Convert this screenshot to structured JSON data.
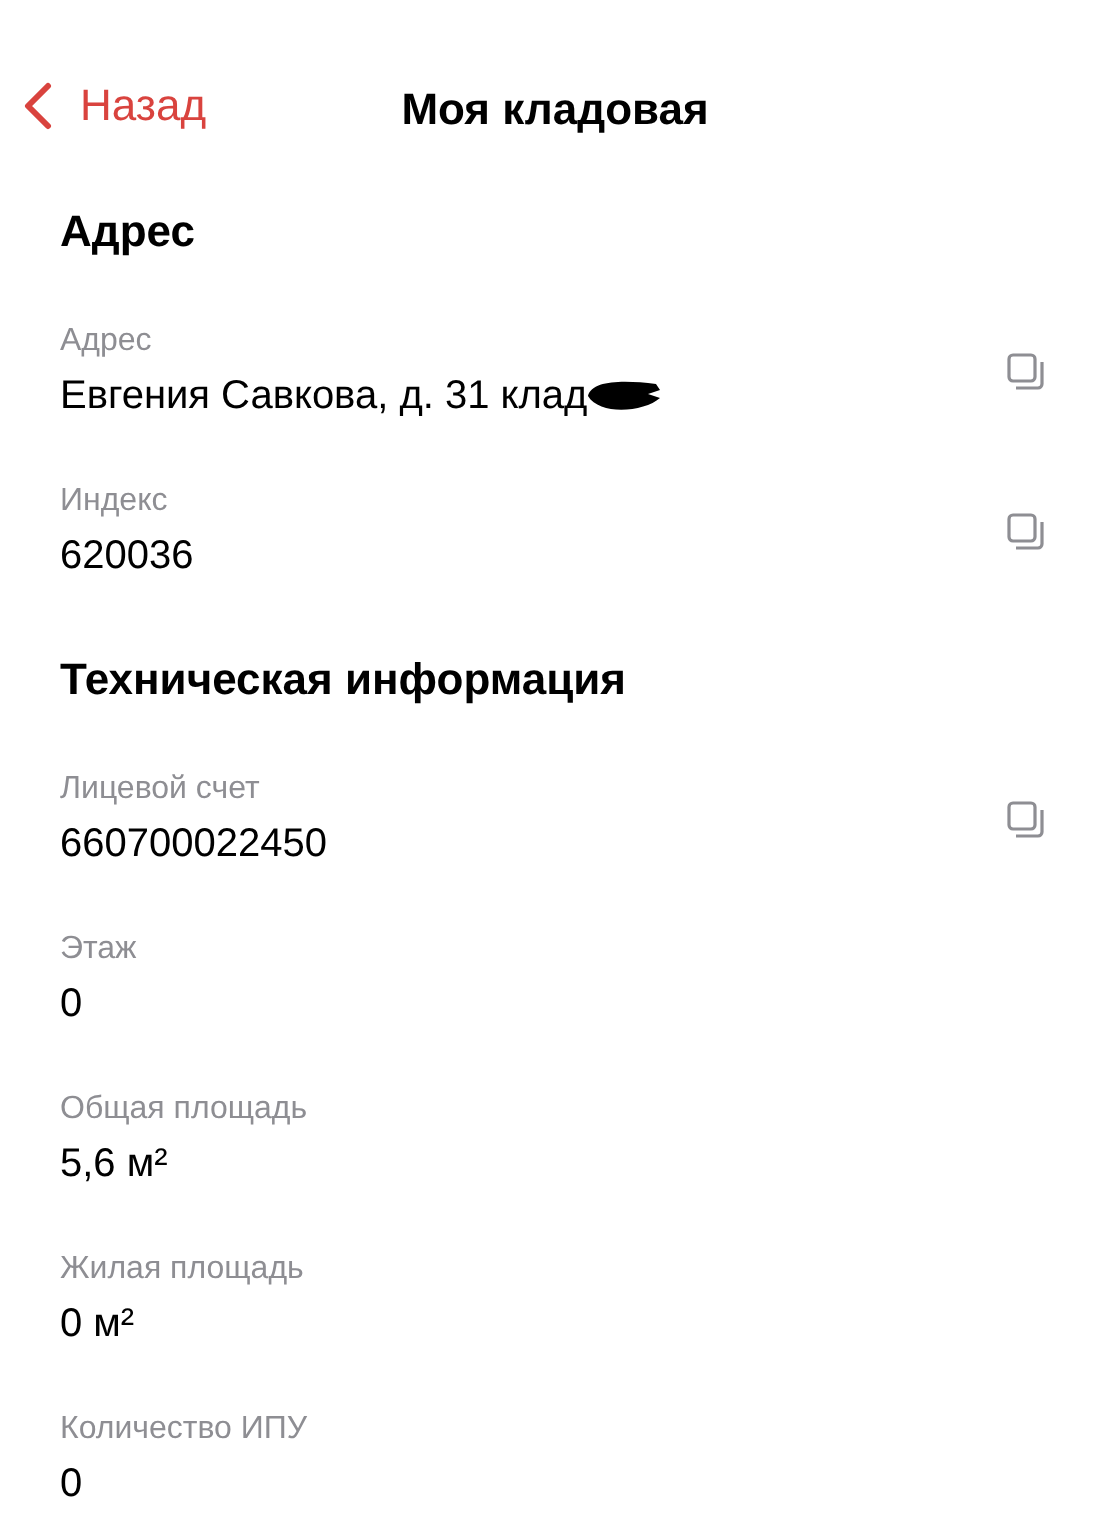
{
  "nav": {
    "back_label": "Назад",
    "title": "Моя кладовая"
  },
  "sections": [
    {
      "title": "Адрес",
      "fields": [
        {
          "label": "Адрес",
          "value": "Евгения Савкова, д. 31 клад",
          "redacted": true,
          "copyable": true
        },
        {
          "label": "Индекс",
          "value": "620036",
          "redacted": false,
          "copyable": true
        }
      ]
    },
    {
      "title": "Техническая информация",
      "fields": [
        {
          "label": "Лицевой счет",
          "value": "660700022450",
          "redacted": false,
          "copyable": true
        },
        {
          "label": "Этаж",
          "value": "0",
          "redacted": false,
          "copyable": false
        },
        {
          "label": "Общая площадь",
          "value": "5,6 м²",
          "redacted": false,
          "copyable": false
        },
        {
          "label": "Жилая площадь",
          "value": "0 м²",
          "redacted": false,
          "copyable": false
        },
        {
          "label": "Количество ИПУ",
          "value": "0",
          "redacted": false,
          "copyable": false
        }
      ]
    }
  ]
}
